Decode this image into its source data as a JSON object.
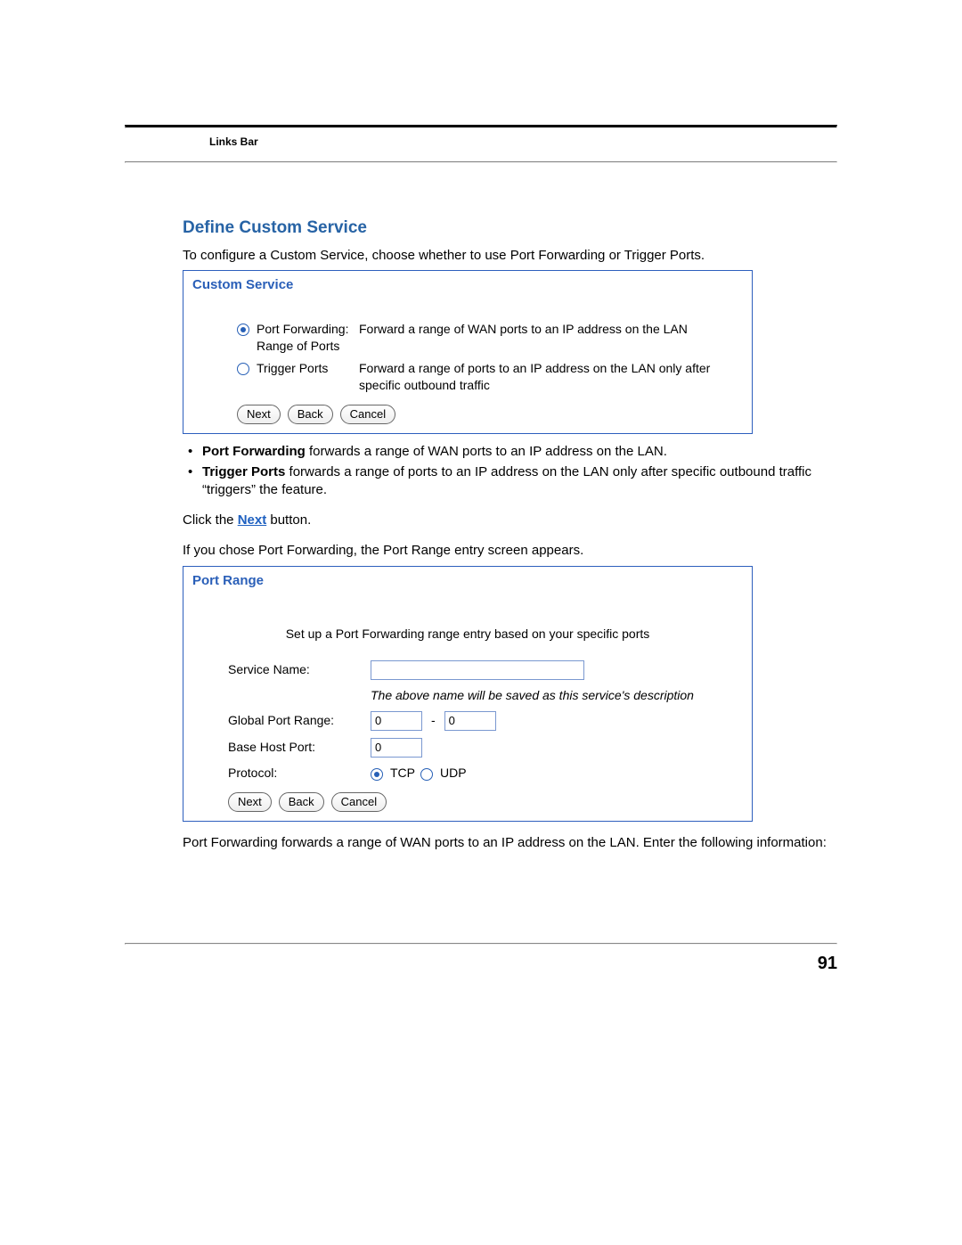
{
  "header": {
    "label": "Links Bar"
  },
  "section": {
    "title": "Define Custom Service",
    "intro": "To configure a Custom Service, choose whether to use Port Forwarding or Trigger Ports."
  },
  "custom_service_panel": {
    "title": "Custom Service",
    "option1": {
      "label": "Port Forwarding: Range of Ports",
      "desc": "Forward a range of WAN ports to an IP address on the LAN",
      "selected": true
    },
    "option2": {
      "label": "Trigger Ports",
      "desc": "Forward a range of ports to an IP address on the LAN only after specific outbound traffic",
      "selected": false
    },
    "buttons": {
      "next": "Next",
      "back": "Back",
      "cancel": "Cancel"
    }
  },
  "bullets": {
    "item1_term": "Port Forwarding",
    "item1_rest": " forwards a range of WAN ports to an IP address on the LAN.",
    "item2_term": "Trigger Ports",
    "item2_rest": " forwards a range of ports to an IP address on the LAN only after specific outbound traffic “triggers” the feature."
  },
  "click_next": {
    "prefix": "Click the ",
    "link": "Next",
    "suffix": " button."
  },
  "port_range_intro": "If you chose Port Forwarding, the Port Range entry screen appears.",
  "port_range_panel": {
    "title": "Port Range",
    "intro": "Set up a Port Forwarding range entry based on your specific ports",
    "service_name_label": "Service Name:",
    "service_name_value": "",
    "service_name_hint": "The above name will be saved as this service's description",
    "global_port_range_label": "Global Port Range:",
    "global_port_from": "0",
    "global_port_to": "0",
    "base_host_port_label": "Base Host Port:",
    "base_host_port_value": "0",
    "protocol_label": "Protocol:",
    "protocol_tcp": "TCP",
    "protocol_udp": "UDP",
    "buttons": {
      "next": "Next",
      "back": "Back",
      "cancel": "Cancel"
    }
  },
  "closing_para": "Port Forwarding forwards a range of WAN ports to an IP address on the LAN. Enter the following information:",
  "page_number": "91"
}
